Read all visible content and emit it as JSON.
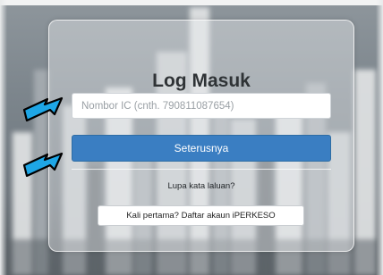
{
  "login": {
    "title": "Log Masuk",
    "ic_placeholder": "Nombor IC (cnth. 790811087654)",
    "ic_value": "",
    "next_label": "Seterusnya",
    "forgot_label": "Lupa kata laluan?",
    "register_label": "Kali pertama? Daftar akaun iPERKESO"
  },
  "colors": {
    "primary_button": "#3a7ec2",
    "arrow_fill": "#1ea6e6",
    "arrow_outline": "#000000"
  },
  "annotations": {
    "arrows": [
      "arrow-right-icon",
      "arrow-right-icon"
    ]
  }
}
